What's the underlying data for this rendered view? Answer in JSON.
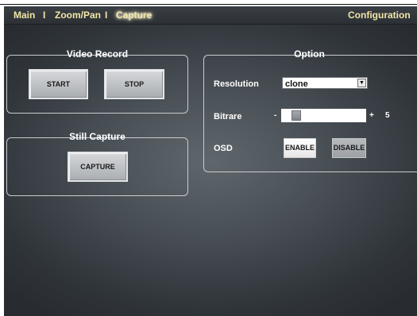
{
  "nav": {
    "main": "Main",
    "sep1": "I",
    "zoom_pan": "Zoom/Pan",
    "sep2": "I",
    "capture": "Capture",
    "configuration": "Configuration"
  },
  "video_record": {
    "title": "Video Record",
    "start_label": "START",
    "stop_label": "STOP"
  },
  "still_capture": {
    "title": "Still Capture",
    "capture_label": "CAPTURE"
  },
  "option": {
    "title": "Option",
    "resolution_label": "Resolution",
    "resolution_value": "clone",
    "bitrate_label": "Bitrare",
    "bitrate_minus": "-",
    "bitrate_plus": "+",
    "bitrate_value": "5",
    "bitrate_level_fraction": 0.12,
    "osd_label": "OSD",
    "enable_label": "ENABLE",
    "disable_label": "DISABLE"
  },
  "colors": {
    "nav_text": "#f2e6a6",
    "panel_border": "#c8ccd0",
    "background_center": "#5f676d",
    "background_edge": "#282c30"
  }
}
